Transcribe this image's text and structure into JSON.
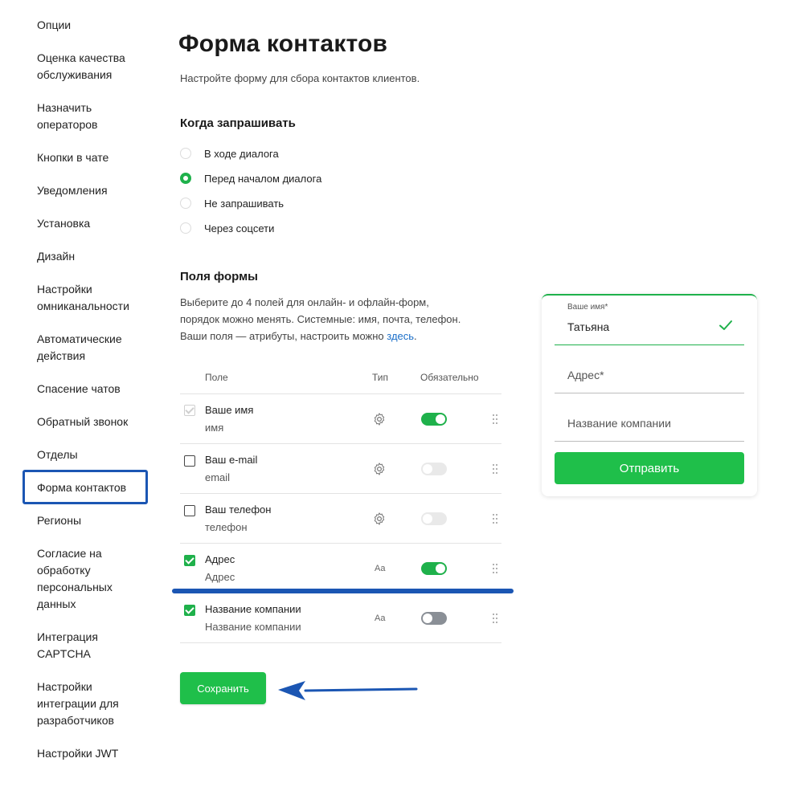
{
  "sidebar": {
    "items": [
      {
        "label": "Опции"
      },
      {
        "label": "Оценка качества обслуживания"
      },
      {
        "label": "Назначить операторов"
      },
      {
        "label": "Кнопки в чате"
      },
      {
        "label": "Уведомления"
      },
      {
        "label": "Установка"
      },
      {
        "label": "Дизайн"
      },
      {
        "label": "Настройки омниканальности"
      },
      {
        "label": "Автоматические действия"
      },
      {
        "label": "Спасение чатов"
      },
      {
        "label": "Обратный звонок"
      },
      {
        "label": "Отделы"
      },
      {
        "label": "Форма контактов"
      },
      {
        "label": "Регионы"
      },
      {
        "label": "Согласие на обработку персональных данных"
      },
      {
        "label": "Интеграция CAPTCHA"
      },
      {
        "label": "Настройки интеграции для разработчиков"
      },
      {
        "label": "Настройки JWT"
      }
    ],
    "active_label": "Форма контактов"
  },
  "main": {
    "title": "Форма контактов",
    "subtitle": "Настройте форму для сбора контактов клиентов.",
    "when_heading": "Когда запрашивать",
    "when_options": [
      {
        "label": "В ходе диалога",
        "selected": false
      },
      {
        "label": "Перед началом диалога",
        "selected": true
      },
      {
        "label": "Не запрашивать",
        "selected": false
      },
      {
        "label": "Через соцсети",
        "selected": false
      }
    ],
    "fields_heading": "Поля формы",
    "fields_desc_1": "Выберите до 4 полей для онлайн- и офлайн-форм,",
    "fields_desc_2": "порядок можно менять. Системные: имя, почта, телефон.",
    "fields_desc_3": "Ваши поля — атрибуты, настроить можно ",
    "fields_desc_link": "здесь",
    "fields_desc_end": ".",
    "table": {
      "col_field": "Поле",
      "col_type": "Тип",
      "col_required": "Обязательно",
      "rows": [
        {
          "name": "Ваше имя",
          "sub": "имя",
          "checked": true,
          "disabled": true,
          "type_icon": "gear-icon",
          "required": true
        },
        {
          "name": "Ваш e-mail",
          "sub": "email",
          "checked": false,
          "disabled": false,
          "type_icon": "gear-icon",
          "required": false
        },
        {
          "name": "Ваш телефон",
          "sub": "телефон",
          "checked": false,
          "disabled": false,
          "type_icon": "gear-icon",
          "required": false
        },
        {
          "name": "Адрес",
          "sub": "Адрес",
          "checked": true,
          "disabled": false,
          "type_icon": "text-type-icon",
          "type_text": "Aa",
          "required": true
        },
        {
          "name": "Название компании",
          "sub": "Название компании",
          "checked": true,
          "disabled": false,
          "type_icon": "text-type-icon",
          "type_text": "Aa",
          "required": false
        }
      ]
    },
    "save_label": "Сохранить"
  },
  "preview": {
    "name_label": "Ваше имя*",
    "name_value": "Татьяна",
    "address_placeholder": "Адрес*",
    "company_placeholder": "Название компании",
    "send_label": "Отправить"
  },
  "colors": {
    "accent_green": "#1fb14b",
    "annotation_blue": "#1b56b3",
    "link_blue": "#1b6fc9"
  }
}
